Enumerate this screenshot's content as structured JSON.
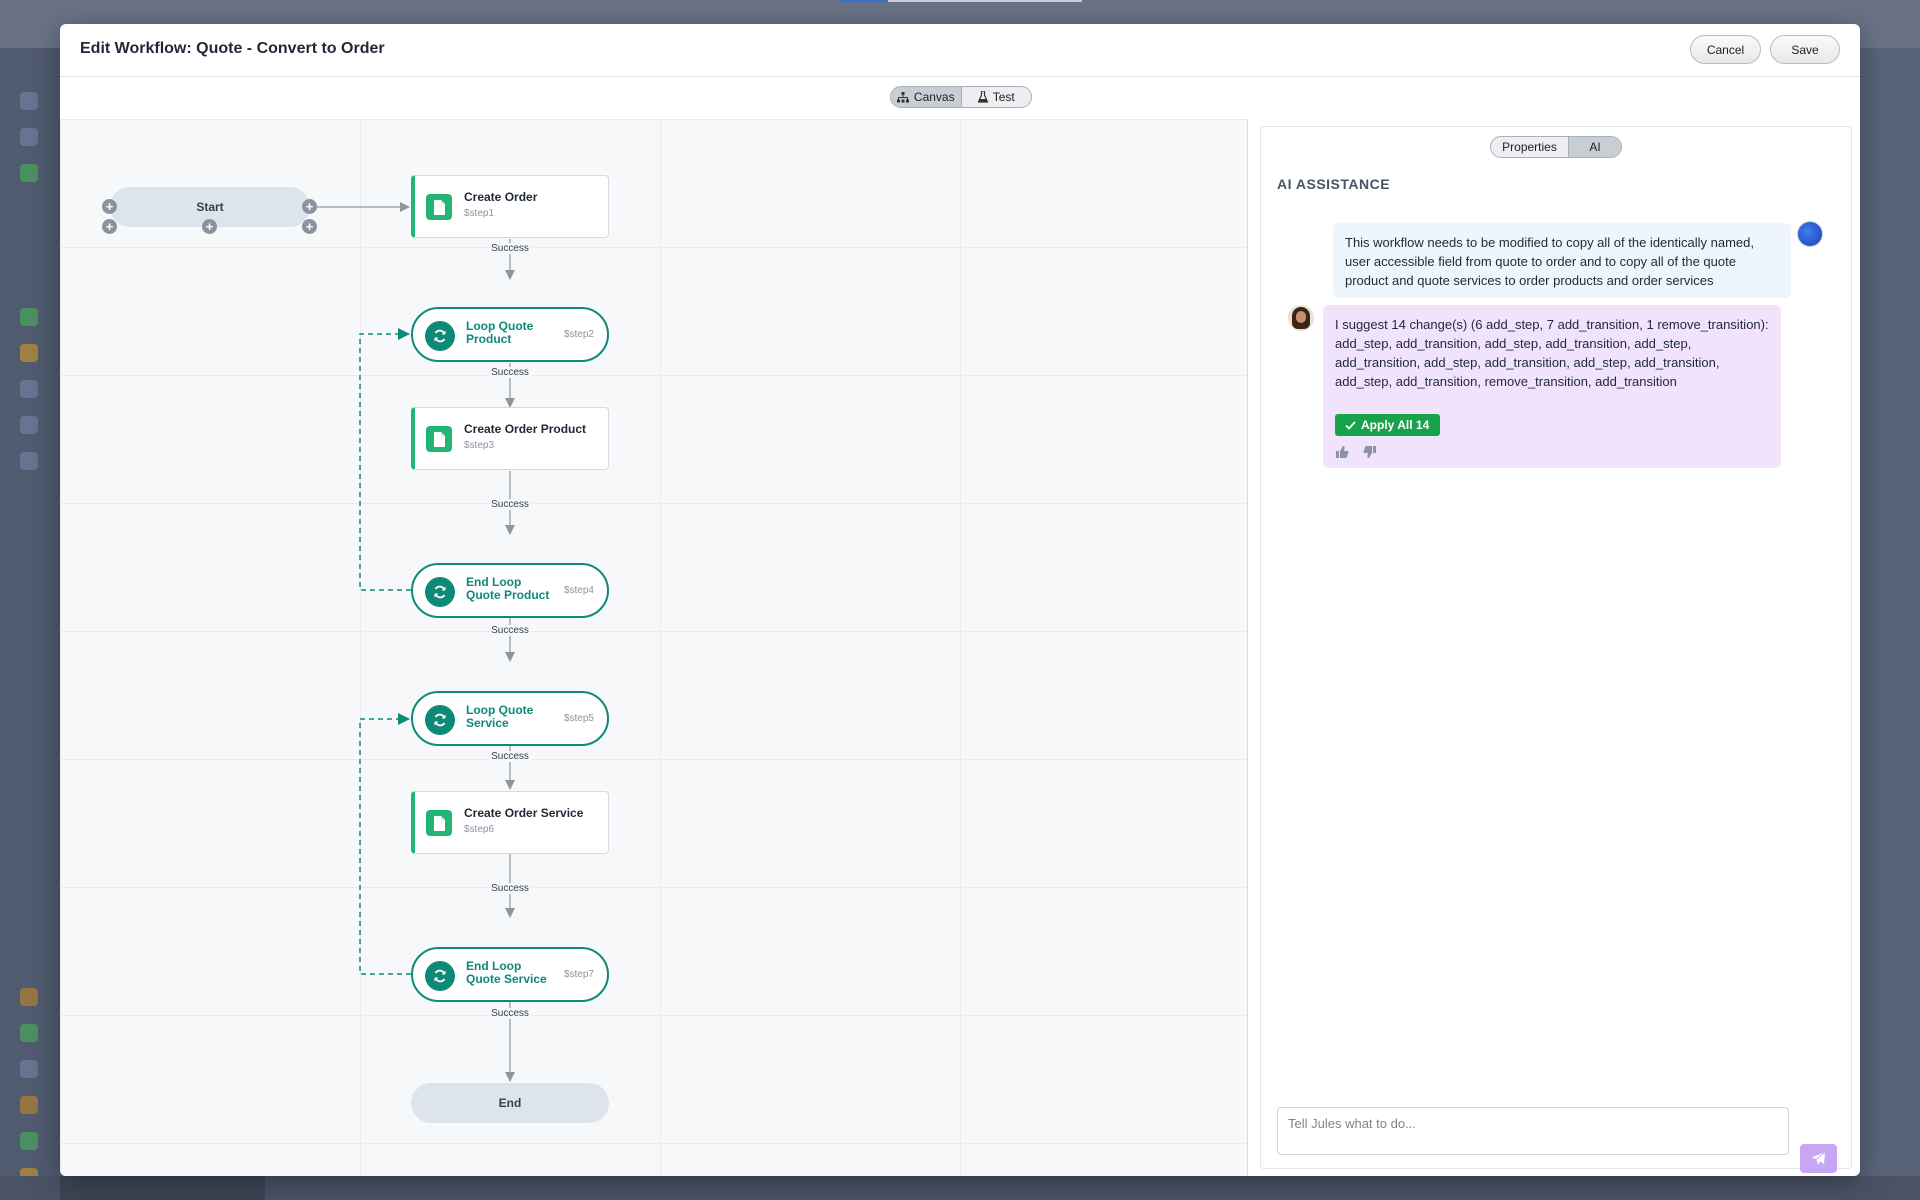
{
  "colors": {
    "accent_green": "#22b573",
    "loop_teal": "#0e8a78",
    "apply_green": "#16a34a",
    "ai_bubble": "#f1e3fb",
    "user_bubble": "#eef5fc",
    "send_purple": "#c7a6f4"
  },
  "modal": {
    "title": "Edit Workflow: Quote - Convert to Order",
    "cancel_label": "Cancel",
    "save_label": "Save"
  },
  "view_toggle": {
    "canvas_label": "Canvas",
    "canvas_icon": "sitemap-icon",
    "test_label": "Test",
    "test_icon": "flask-icon",
    "active": "Canvas"
  },
  "workflow": {
    "start_label": "Start",
    "end_label": "End",
    "edge_label": "Success",
    "steps": [
      {
        "kind": "step",
        "title": "Create Order",
        "id": "$step1"
      },
      {
        "kind": "loop",
        "title": "Loop Quote Product",
        "id": "$step2"
      },
      {
        "kind": "step",
        "title": "Create Order Product",
        "id": "$step3"
      },
      {
        "kind": "loop",
        "title": "End Loop Quote Product",
        "id": "$step4"
      },
      {
        "kind": "loop",
        "title": "Loop Quote Service",
        "id": "$step5"
      },
      {
        "kind": "step",
        "title": "Create Order Service",
        "id": "$step6"
      },
      {
        "kind": "loop",
        "title": "End Loop Quote Service",
        "id": "$step7"
      }
    ]
  },
  "panel": {
    "tab_properties": "Properties",
    "tab_ai": "AI",
    "active_tab": "AI",
    "heading": "AI ASSISTANCE",
    "user_message": "This workflow needs to be modified to copy all of the identically named, user accessible field from quote to order and to copy all of the quote product and quote services to order products and order services",
    "ai_message": "I suggest 14 change(s) (6 add_step, 7 add_transition, 1 remove_transition): add_step, add_transition, add_step, add_transition, add_step, add_transition, add_step, add_transition, add_step, add_transition, add_step, add_transition, remove_transition, add_transition",
    "apply_label": "Apply All 14",
    "input_placeholder": "Tell Jules what to do...",
    "input_value": ""
  }
}
